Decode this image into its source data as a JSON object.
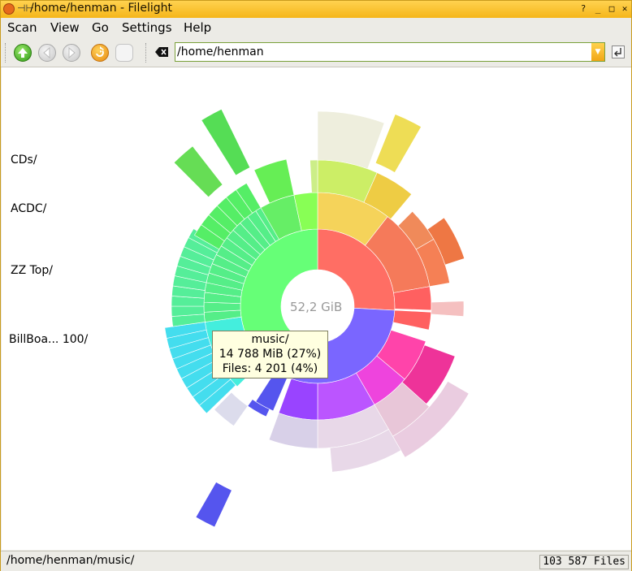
{
  "window": {
    "title": "/home/henman - Filelight",
    "pin_glyph": "⊣⊢"
  },
  "menubar": {
    "items": [
      {
        "label": "Scan"
      },
      {
        "label": "View"
      },
      {
        "label": "Go"
      },
      {
        "label": "Settings"
      },
      {
        "label": "Help"
      }
    ]
  },
  "toolbar": {
    "icons": [
      "up-icon",
      "back-icon",
      "forward-icon",
      "rescan-icon",
      "stop-icon",
      "clear-location-icon",
      "go-icon"
    ],
    "location": "/home/henman"
  },
  "radial_map": {
    "center_label": "52,2 GiB",
    "labels": [
      "CDs/",
      "ACDC/",
      "ZZ Top/",
      "BillBoa... 100/"
    ],
    "tooltip": {
      "name": "music/",
      "size": "14 788 MiB (27%)",
      "files": "Files: 4 201 (4%)"
    }
  },
  "statusbar": {
    "path": "/home/henman/music/",
    "files": "103 587 Files"
  },
  "colors": {
    "titlebar": "#f5b61a",
    "music": "#66ff77",
    "red": "#ff6e64",
    "blue": "#7a66ff",
    "cyan": "#55eeee"
  }
}
